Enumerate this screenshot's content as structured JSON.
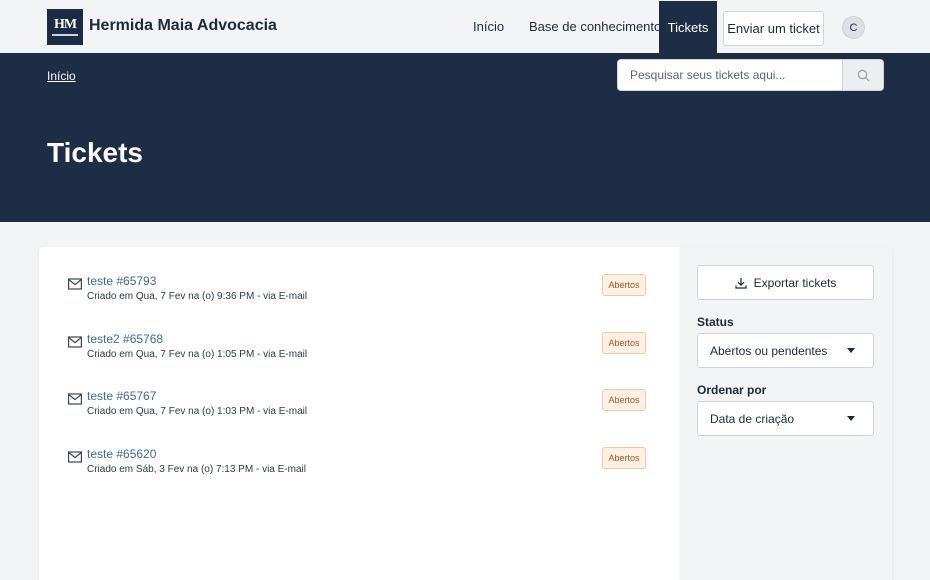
{
  "header": {
    "logo_text": "HM",
    "brand": "Hermida Maia Advocacia",
    "nav": {
      "inicio": "Início",
      "base": "Base de conhecimento",
      "tickets": "Tickets"
    },
    "submit_button": "Enviar um ticket",
    "avatar_initial": "C"
  },
  "hero": {
    "breadcrumb": "Início",
    "search_placeholder": "Pesquisar seus tickets aqui...",
    "title": "Tickets"
  },
  "tickets": [
    {
      "title": "teste #65793",
      "meta": "Criado em Qua, 7 Fev na (o) 9:36 PM - via E-mail",
      "status": "Abertos",
      "icon": "envelope-icon"
    },
    {
      "title": "teste2 #65768",
      "meta": "Criado em Qua, 7 Fev na (o) 1:05 PM - via E-mail",
      "status": "Abertos",
      "icon": "envelope-icon"
    },
    {
      "title": "teste #65767",
      "meta": "Criado em Qua, 7 Fev na (o) 1:03 PM - via E-mail",
      "status": "Abertos",
      "icon": "envelope-icon"
    },
    {
      "title": "teste #65620",
      "meta": "Criado em Sáb, 3 Fev na (o) 7:13 PM - via E-mail",
      "status": "Abertos",
      "icon": "envelope-icon"
    }
  ],
  "sidebar": {
    "export_button": "Exportar tickets",
    "status_label": "Status",
    "status_value": "Abertos ou pendentes",
    "sort_label": "Ordenar por",
    "sort_value": "Data de criação"
  },
  "colors": {
    "navy": "#1c2d45",
    "link": "#3b6aa8",
    "badge_bg": "#fdf1e6",
    "badge_text": "#b4531c"
  }
}
